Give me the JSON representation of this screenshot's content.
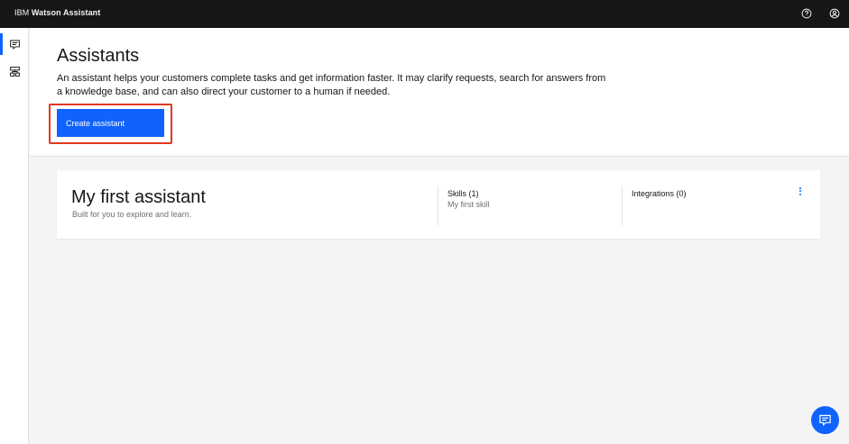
{
  "app": {
    "brand_prefix": "IBM",
    "brand_name": "Watson Assistant"
  },
  "topbar": {
    "icons": [
      "help-icon",
      "user-avatar-icon"
    ]
  },
  "sidenav": {
    "items": [
      {
        "icon": "chat-icon",
        "active": true
      },
      {
        "icon": "skills-icon",
        "active": false
      }
    ]
  },
  "header": {
    "title": "Assistants",
    "description": "An assistant helps your customers complete tasks and get information faster. It may clarify requests, search for answers from a knowledge base, and can also direct your customer to a human if needed.",
    "create_button_label": "Create assistant"
  },
  "assistants": [
    {
      "name": "My first assistant",
      "subtitle": "Built for you to explore and learn.",
      "skills_label": "Skills (1)",
      "skills_items": [
        "My first skill"
      ],
      "integrations_label": "Integrations (0)"
    }
  ],
  "colors": {
    "accent": "#0f62fe",
    "topbar": "#161616",
    "highlight": "#e0391f"
  }
}
